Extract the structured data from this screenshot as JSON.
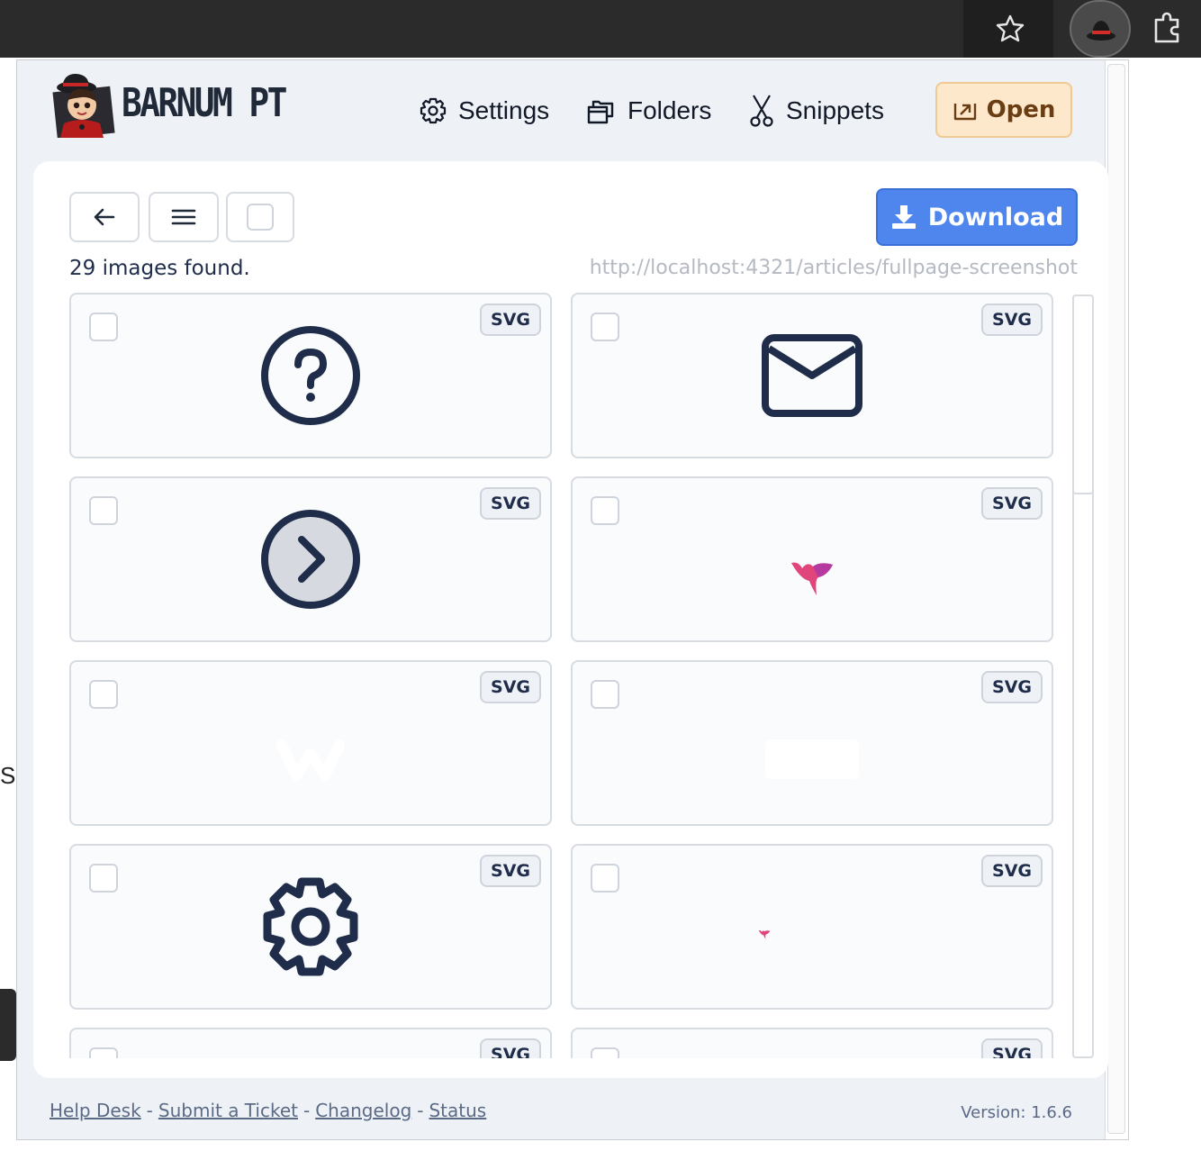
{
  "browser": {
    "icons": [
      "bookmark-star-icon",
      "barnum-extension-icon",
      "extensions-puzzle-icon"
    ],
    "background_text": "S"
  },
  "header": {
    "brand": "BARNUM PT",
    "nav": [
      {
        "label": "Settings",
        "icon": "gear-icon"
      },
      {
        "label": "Folders",
        "icon": "folders-icon"
      },
      {
        "label": "Snippets",
        "icon": "scissors-icon"
      }
    ],
    "open_label": "Open"
  },
  "toolbar": {
    "back_icon": "arrow-left-icon",
    "menu_icon": "hamburger-icon",
    "download_label": "Download"
  },
  "results": {
    "count_text": "29 images found.",
    "url": "http://localhost:4321/articles/fullpage-screenshot"
  },
  "tiles": [
    {
      "type": "SVG",
      "icon": "question-circle"
    },
    {
      "type": "SVG",
      "icon": "envelope"
    },
    {
      "type": "SVG",
      "icon": "chevron-right-circle"
    },
    {
      "type": "SVG",
      "icon": "pink-logo"
    },
    {
      "type": "SVG",
      "icon": "white-logo"
    },
    {
      "type": "SVG",
      "icon": "white-envelope"
    },
    {
      "type": "SVG",
      "icon": "gear"
    },
    {
      "type": "SVG",
      "icon": "small-pink-logo"
    },
    {
      "type": "SVG",
      "icon": "partial"
    },
    {
      "type": "SVG",
      "icon": "partial"
    }
  ],
  "footer": {
    "links": [
      "Help Desk",
      "Submit a Ticket",
      "Changelog",
      "Status"
    ],
    "separator": "-",
    "version": "Version: 1.6.6"
  },
  "colors": {
    "accent_blue": "#4f86ee",
    "open_bg": "#fde8cc",
    "icon_navy": "#1f2d4a",
    "logo_pink": "#e0457b"
  }
}
